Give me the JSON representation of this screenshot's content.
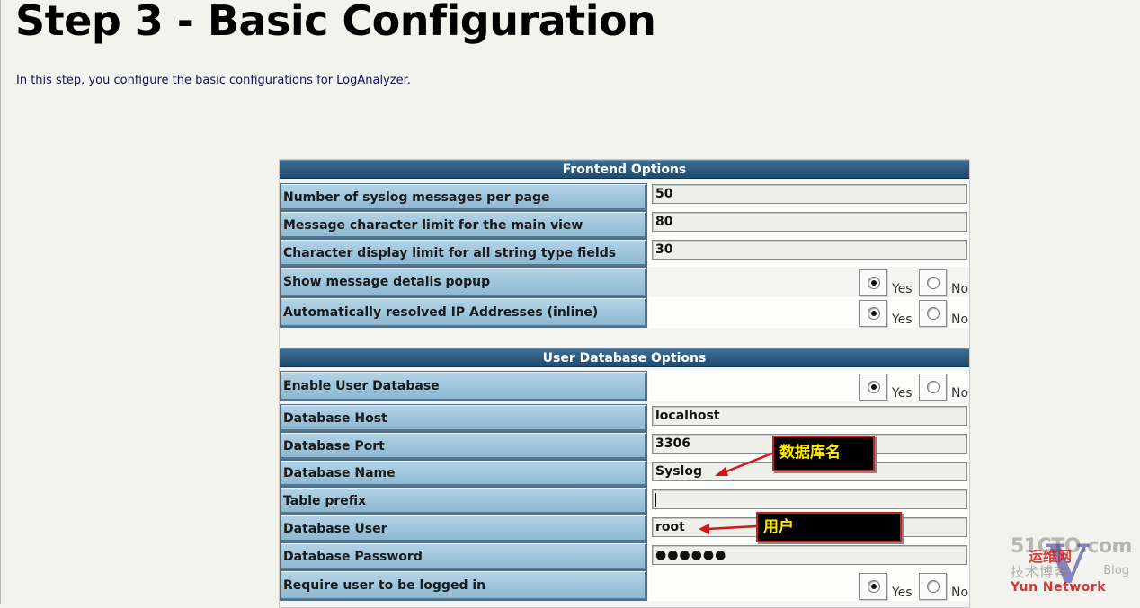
{
  "page": {
    "title": "Step 3 - Basic Configuration",
    "intro": "In this step, you configure the basic configurations for LogAnalyzer."
  },
  "frontend": {
    "header": "Frontend Options",
    "rows": [
      {
        "label": "Number of syslog messages per page",
        "value": "50"
      },
      {
        "label": "Message character limit for the main view",
        "value": "80"
      },
      {
        "label": "Character display limit for all string type fields",
        "value": "30"
      },
      {
        "label": "Show message details popup",
        "options": [
          "Yes",
          "No"
        ],
        "selected": "Yes"
      },
      {
        "label": "Automatically resolved IP Addresses (inline)",
        "options": [
          "Yes",
          "No"
        ],
        "selected": "Yes"
      }
    ]
  },
  "userdb": {
    "header": "User Database Options",
    "rows": [
      {
        "label": "Enable User Database",
        "options": [
          "Yes",
          "No"
        ],
        "selected": "Yes"
      },
      {
        "label": "Database Host",
        "value": "localhost"
      },
      {
        "label": "Database Port",
        "value": "3306"
      },
      {
        "label": "Database Name",
        "value": "Syslog"
      },
      {
        "label": "Table prefix",
        "value": ""
      },
      {
        "label": "Database User",
        "value": "root"
      },
      {
        "label": "Database Password",
        "value": "●●●●●●"
      },
      {
        "label": "Require user to be logged in",
        "options": [
          "Yes",
          "No"
        ],
        "selected": "Yes"
      }
    ]
  },
  "annotations": {
    "db_name_note": "数据库名",
    "db_user_note": "用户",
    "arrow_color": "#d01818"
  },
  "watermark": {
    "site": "51CTO.com",
    "subtitle": "技术博客",
    "red_text": "运维网",
    "blog": "Blog",
    "v_mark": "V",
    "network": "Yun Network"
  },
  "colors": {
    "header_bg": "#2a5b80",
    "label_bg": "#9fc6dc",
    "annotation_bg": "#000000",
    "annotation_text": "#ffe800"
  }
}
